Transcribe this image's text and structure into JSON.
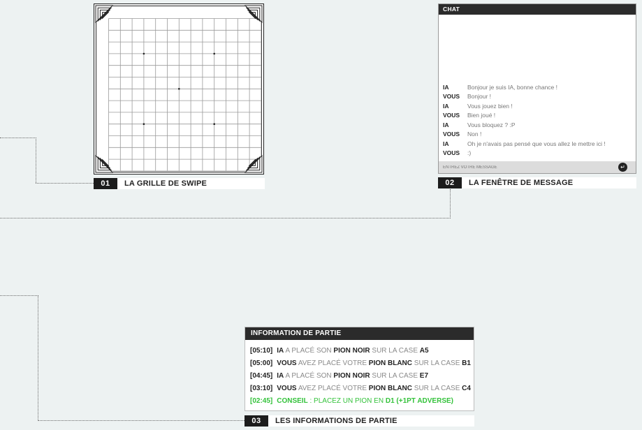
{
  "board": {
    "title": "",
    "grid_size": 13,
    "star_points": [
      [
        3,
        3
      ],
      [
        9,
        3
      ],
      [
        6,
        6
      ],
      [
        3,
        9
      ],
      [
        9,
        9
      ]
    ]
  },
  "chat": {
    "header": "CHAT",
    "messages": [
      {
        "who": "IA",
        "text": "Bonjour je suis IA, bonne chance !"
      },
      {
        "who": "VOUS",
        "text": "Bonjour !"
      },
      {
        "who": "IA",
        "text": "Vous jouez bien !"
      },
      {
        "who": "VOUS",
        "text": "Bien joué !"
      },
      {
        "who": "IA",
        "text": "Vous bloquez ? :P"
      },
      {
        "who": "VOUS",
        "text": "Non !"
      },
      {
        "who": "IA",
        "text": "Oh je n'avais pas pensé que vous allez le mettre ici !"
      },
      {
        "who": "VOUS",
        "text": ":)"
      }
    ],
    "input_placeholder": "ENTREZ VOTRE MESSAGE",
    "send_icon": "enter-arrow-icon",
    "send_glyph": "↵"
  },
  "info": {
    "header": "INFORMATION DE PARTIE",
    "lines": [
      {
        "time": "[05:10]",
        "parts": [
          [
            "b",
            "IA"
          ],
          [
            "l",
            " A PLACÉ SON "
          ],
          [
            "b",
            "PION NOIR"
          ],
          [
            "l",
            " SUR LA CASE "
          ],
          [
            "b",
            "A5"
          ]
        ]
      },
      {
        "time": "[05:00]",
        "parts": [
          [
            "b",
            "VOUS"
          ],
          [
            "l",
            " AVEZ PLACÉ VOTRE "
          ],
          [
            "b",
            "PION BLANC"
          ],
          [
            "l",
            " SUR LA CASE "
          ],
          [
            "b",
            "B1"
          ]
        ]
      },
      {
        "time": "[04:45]",
        "parts": [
          [
            "b",
            "IA"
          ],
          [
            "l",
            " A PLACÉ SON "
          ],
          [
            "b",
            "PION NOIR"
          ],
          [
            "l",
            " SUR LA CASE "
          ],
          [
            "b",
            "E7"
          ]
        ]
      },
      {
        "time": "[03:10]",
        "parts": [
          [
            "b",
            "VOUS"
          ],
          [
            "l",
            " AVEZ PLACÉ VOTRE "
          ],
          [
            "b",
            "PION BLANC"
          ],
          [
            "l",
            " SUR LA CASE "
          ],
          [
            "b",
            "C4"
          ]
        ]
      },
      {
        "time": "[02:45]",
        "parts": [
          [
            "b",
            "CONSEIL"
          ],
          [
            "l",
            " : PLACEZ UN PION EN "
          ],
          [
            "b",
            "D1 (+1PT ADVERSE)"
          ]
        ],
        "highlight": true
      }
    ]
  },
  "captions": {
    "c1": {
      "num": "01",
      "text": "LA GRILLE DE SWIPE"
    },
    "c2": {
      "num": "02",
      "text": "LA FENÊTRE DE MESSAGE"
    },
    "c3": {
      "num": "03",
      "text": "LES INFORMATIONS DE PARTIE"
    }
  },
  "colors": {
    "background": "#edf2f2",
    "dark": "#1c1c1c",
    "muted_text": "#8a8a8a",
    "advice_green": "#33c23a"
  }
}
